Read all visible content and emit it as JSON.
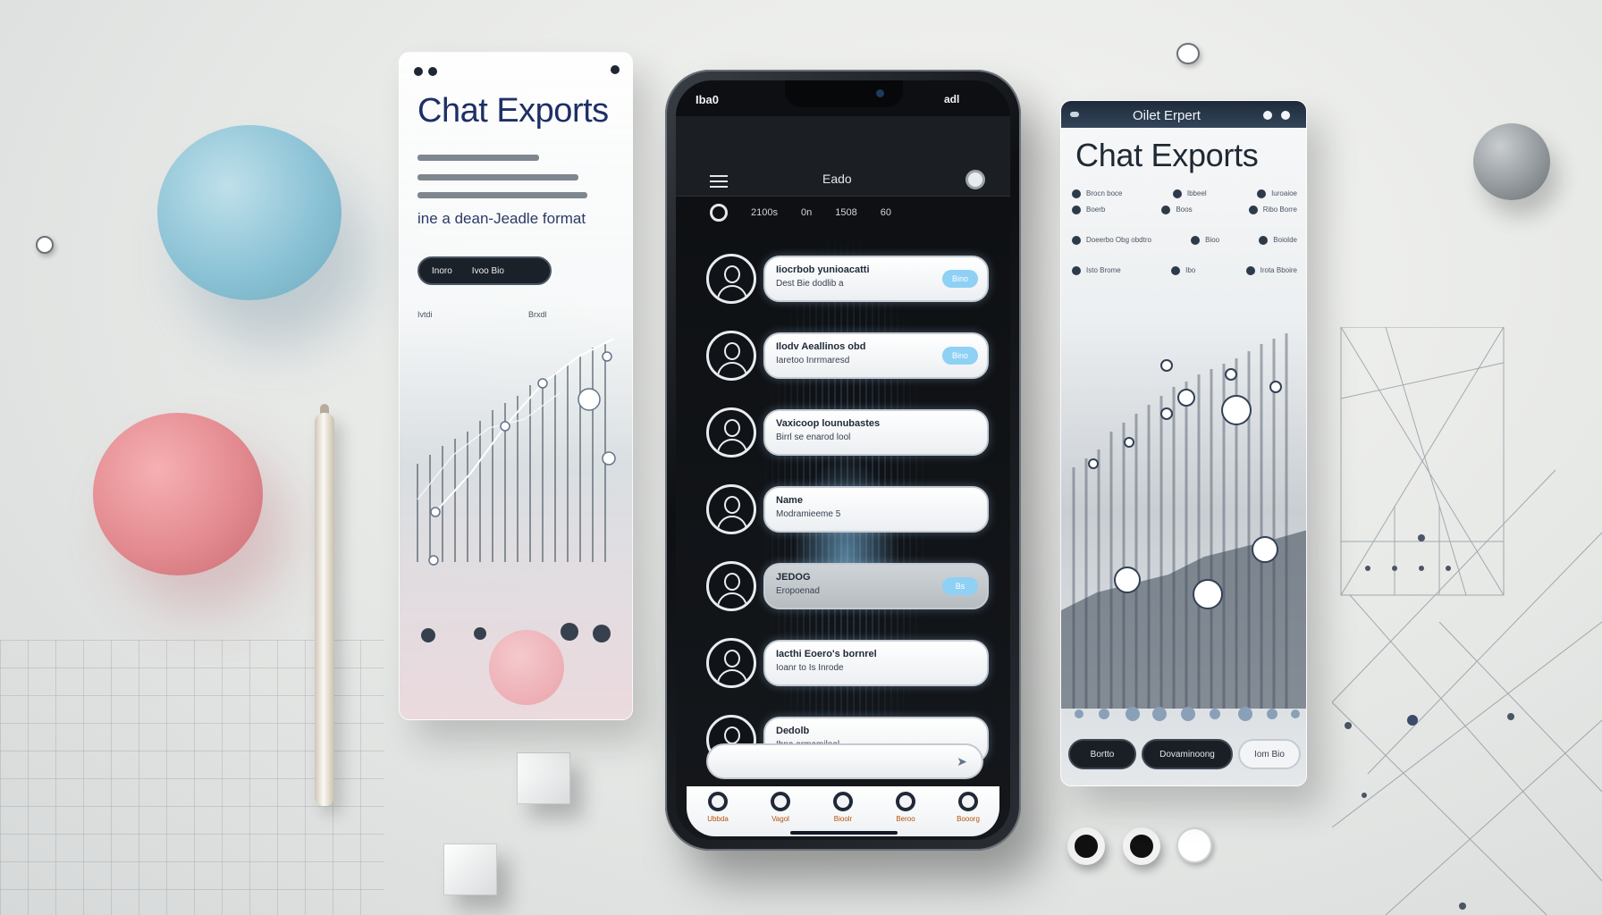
{
  "left_panel": {
    "title": "Chat Exports",
    "subtitle": "ine a dean-Jeadle format",
    "button": {
      "left": "Inoro",
      "right": "Ivoo Bio"
    },
    "chart_labels": {
      "left": "Ivtdi",
      "right": "Brxdl"
    }
  },
  "phone": {
    "status": {
      "time": "Iba0",
      "right": "adl"
    },
    "app_title": "Eado",
    "filters": [
      "2100s",
      "0n",
      "1508",
      "60"
    ],
    "chats": [
      {
        "name": "Iiocrbob yunioacatti",
        "preview": "Dest Bie dodlib a",
        "badge": "Bino",
        "dim": false
      },
      {
        "name": "Ilodv Aeallinos obd",
        "preview": "Iaretoo Inrrmaresd",
        "badge": "Bino",
        "dim": false
      },
      {
        "name": "Vaxicoop lounubastes",
        "preview": "Birrl se enarod lool",
        "badge": "",
        "dim": false
      },
      {
        "name": "Name",
        "preview": "Modramieeme 5",
        "badge": "",
        "dim": false
      },
      {
        "name": "JEDOG",
        "preview": "Eropoenad",
        "badge": "Bs",
        "dim": true
      },
      {
        "name": "Iacthi Eoero's bornrel",
        "preview": "Ioanr to Is Inrode",
        "badge": "",
        "dim": false
      },
      {
        "name": "Dedolb",
        "preview": "Ibna armamiloal",
        "badge": "",
        "dim": false
      }
    ],
    "compose_placeholder": "",
    "tabs": [
      "Ubbda",
      "Vagol",
      "Bioolr",
      "Beroo",
      "Booorg"
    ]
  },
  "right_panel": {
    "bar_title": "Oilet Erpert",
    "title": "Chat Exports",
    "stats": [
      {
        "a": "Brocn boce",
        "b": "Ibbeel",
        "c": "Iuroaioe"
      },
      {
        "a": "Boerb",
        "b": "Boos",
        "c": "Ribo Borre"
      },
      {
        "a": "Doeerbo Obg obdtro",
        "b": "Bioo",
        "c": "Boiolde"
      },
      {
        "a": "Isto Brome",
        "b": "Ibo",
        "c": "Irota Bboire"
      }
    ],
    "buttons": [
      "Bortto",
      "Dovaminoong",
      "Iom Bio"
    ]
  },
  "colors": {
    "accent_blue": "#8fd0f5",
    "phone_frame": "#0d0f12",
    "title_navy": "#1d2f66"
  }
}
